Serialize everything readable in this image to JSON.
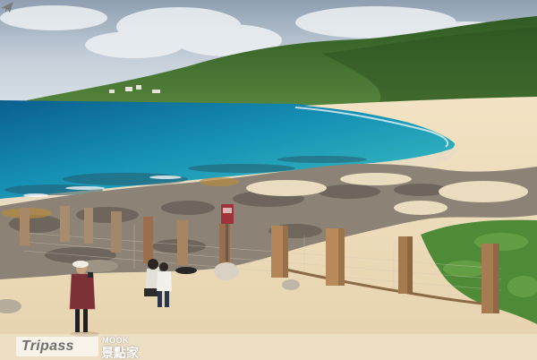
{
  "image": {
    "scene": "tropical coastline: turquoise bay, green hill, sandy beach, rocky coral shore with wooden fence posts and netting, visitors on the sand"
  },
  "watermark": {
    "brand": "Tripass",
    "publisher": "MOOK",
    "chinese": "景點家",
    "icon": "airplane-icon"
  },
  "sign": {
    "color": "#a0323a"
  },
  "colors": {
    "sky": "#b9c6d3",
    "sea_deep": "#0e6f9e",
    "sea_shallow": "#35b9c0",
    "hill": "#3f6e2e",
    "sand": "#ecdcbf",
    "rock": "#8b8277",
    "post": "#9e7b55"
  }
}
